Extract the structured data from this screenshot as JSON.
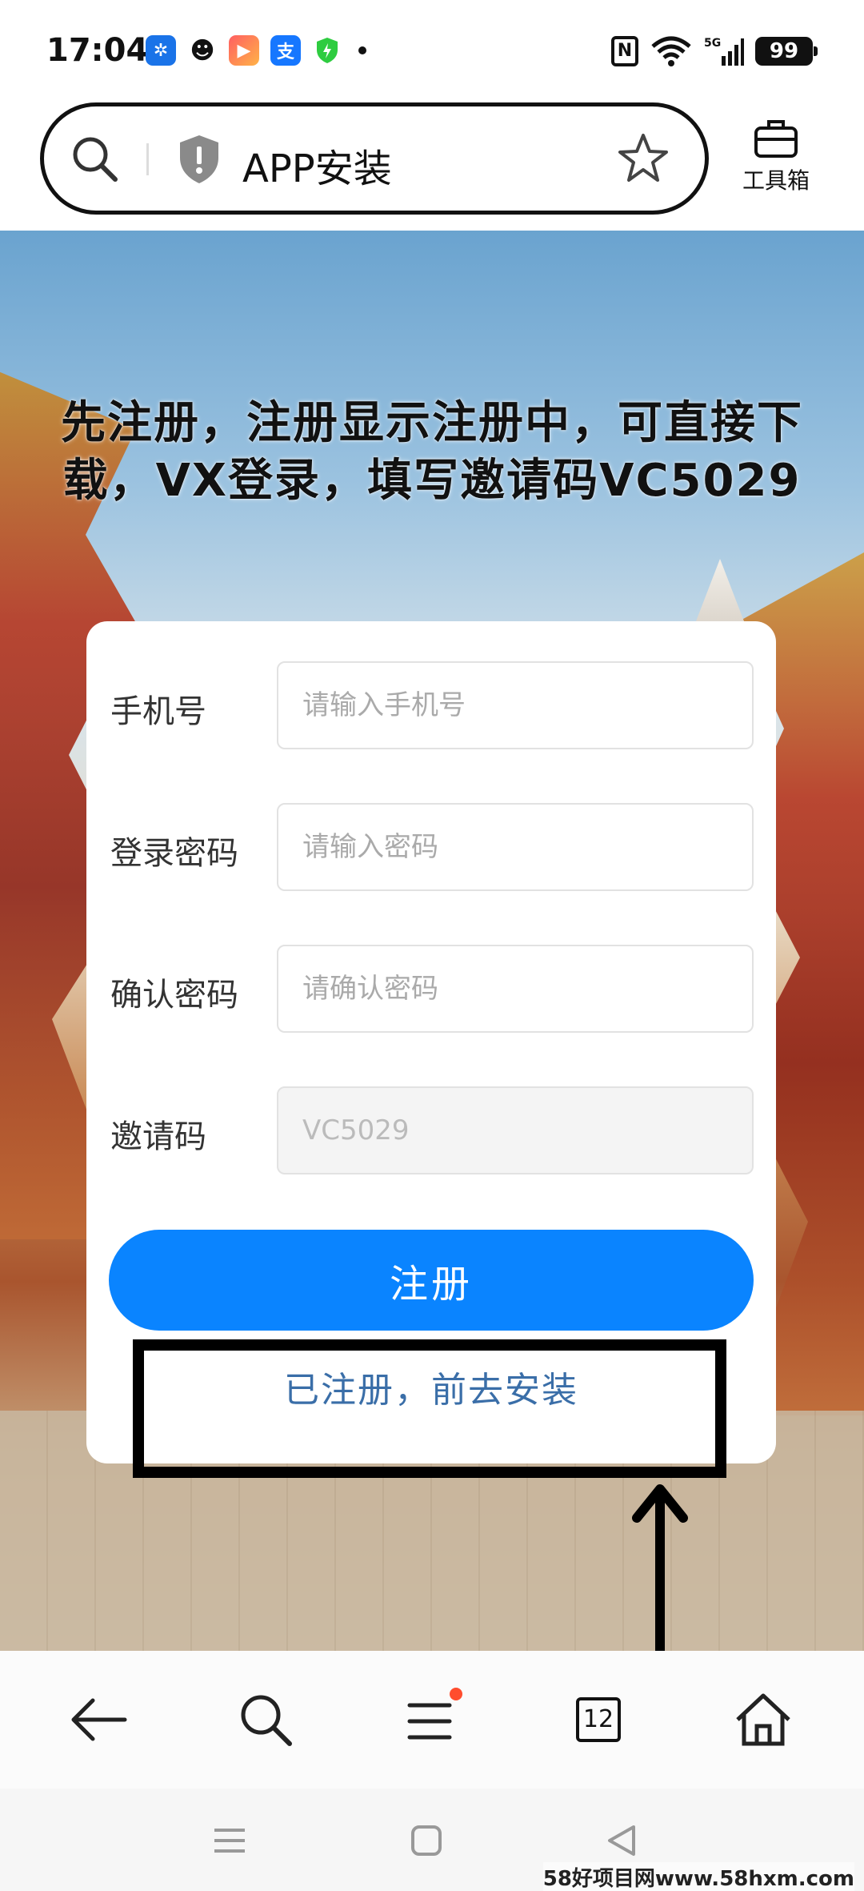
{
  "status_bar": {
    "time": "17:04",
    "battery": "99",
    "icons": [
      "pinwheel-app-icon",
      "qq-icon",
      "video-app-icon",
      "alipay-icon",
      "shield-icon",
      "nfc-icon",
      "wifi-icon",
      "signal-5g-icon",
      "battery-icon"
    ]
  },
  "address_bar": {
    "title": "APP安装",
    "toolbox_label": "工具箱"
  },
  "promo": {
    "text": "先注册，注册显示注册中，可直接下载，VX登录，填写邀请码VC5029"
  },
  "form": {
    "phone": {
      "label": "手机号",
      "placeholder": "请输入手机号"
    },
    "password": {
      "label": "登录密码",
      "placeholder": "请输入密码"
    },
    "confirm": {
      "label": "确认密码",
      "placeholder": "请确认密码"
    },
    "invite": {
      "label": "邀请码",
      "value": "VC5029"
    },
    "register_button": "注册",
    "installed_link": "已注册，前去安装"
  },
  "browser_nav": {
    "tab_count": "12"
  },
  "watermark": "58好项目网www.58hxm.com"
}
